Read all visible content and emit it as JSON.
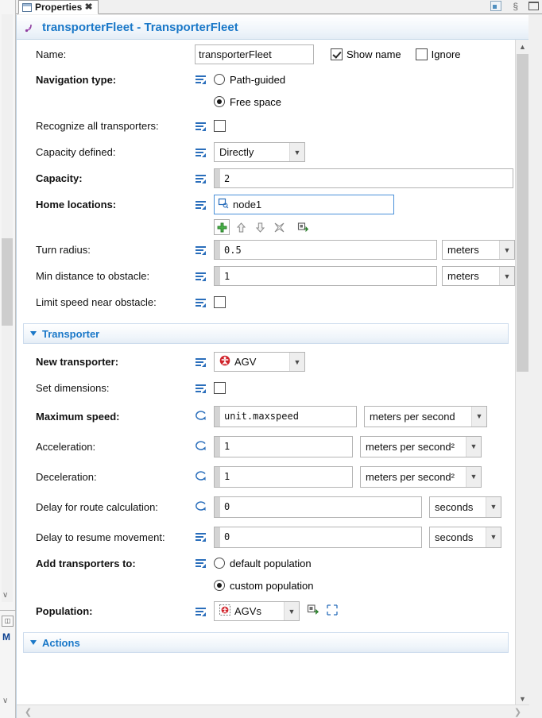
{
  "window": {
    "tab": {
      "label": "Properties",
      "icon": "properties-view-icon",
      "close_icon": "close-icon"
    },
    "toolbar": {
      "minimize_icon": "minimize-icon",
      "link_icon": "link-with-editor-icon",
      "maximize_icon": "maximize-icon"
    }
  },
  "header": {
    "icon": "transporter-fleet-icon",
    "title": "transporterFleet - TransporterFleet",
    "accent_color": "#1a78c8"
  },
  "general": {
    "name": {
      "label": "Name:",
      "value": "transporterFleet",
      "show_name": {
        "label": "Show name",
        "checked": true
      },
      "ignore": {
        "label": "Ignore",
        "checked": false
      }
    },
    "navigation_type": {
      "label": "Navigation type:",
      "icon": "static-value-icon",
      "options": [
        {
          "label": "Path-guided",
          "selected": false
        },
        {
          "label": "Free space",
          "selected": true
        }
      ]
    },
    "recognize_all_transporters": {
      "label": "Recognize all transporters:",
      "icon": "static-value-icon",
      "checked": false
    },
    "capacity_defined": {
      "label": "Capacity defined:",
      "icon": "static-value-icon",
      "value": "Directly"
    },
    "capacity": {
      "label": "Capacity:",
      "icon": "static-value-icon",
      "value": "2"
    },
    "home_locations": {
      "label": "Home locations:",
      "icon": "static-value-icon",
      "value": "node1",
      "item_icon": "node-icon",
      "buttons": [
        {
          "name": "add-button",
          "icon": "plus-icon"
        },
        {
          "name": "move-up-button",
          "icon": "arrow-up-icon"
        },
        {
          "name": "move-down-button",
          "icon": "arrow-down-icon"
        },
        {
          "name": "remove-button",
          "icon": "x-icon"
        },
        {
          "name": "navigate-to-button",
          "icon": "jump-to-icon"
        }
      ]
    },
    "turn_radius": {
      "label": "Turn radius:",
      "icon": "static-value-icon",
      "value": "0.5",
      "unit": "meters"
    },
    "min_distance_to_obstacle": {
      "label": "Min distance to obstacle:",
      "icon": "static-value-icon",
      "value": "1",
      "unit": "meters"
    },
    "limit_speed_near_obstacle": {
      "label": "Limit speed near obstacle:",
      "icon": "static-value-icon",
      "checked": false
    }
  },
  "transporter_section": {
    "title": "Transporter",
    "collapse_icon": "triangle-down-icon",
    "new_transporter": {
      "label": "New transporter:",
      "icon": "static-value-icon",
      "value": "AGV",
      "value_icon": "agv-agent-icon"
    },
    "set_dimensions": {
      "label": "Set dimensions:",
      "icon": "static-value-icon",
      "checked": false
    },
    "maximum_speed": {
      "label": "Maximum speed:",
      "icon": "dynamic-value-icon",
      "value": "unit.maxspeed",
      "unit": "meters per second"
    },
    "acceleration": {
      "label": "Acceleration:",
      "icon": "dynamic-value-icon",
      "value": "1",
      "unit": "meters per second²"
    },
    "deceleration": {
      "label": "Deceleration:",
      "icon": "dynamic-value-icon",
      "value": "1",
      "unit": "meters per second²"
    },
    "delay_for_route_calculation": {
      "label": "Delay for route calculation:",
      "icon": "dynamic-value-icon",
      "value": "0",
      "unit": "seconds"
    },
    "delay_to_resume_movement": {
      "label": "Delay to resume movement:",
      "icon": "static-value-icon",
      "value": "0",
      "unit": "seconds"
    },
    "add_transporters_to": {
      "label": "Add transporters to:",
      "icon": "static-value-icon",
      "options": [
        {
          "label": "default population",
          "selected": false
        },
        {
          "label": "custom population",
          "selected": true
        }
      ]
    },
    "population": {
      "label": "Population:",
      "icon": "static-value-icon",
      "value": "AGVs",
      "value_icon": "agv-population-icon",
      "buttons": [
        {
          "name": "navigate-to-population-button",
          "icon": "jump-to-icon"
        },
        {
          "name": "select-population-button",
          "icon": "marquee-select-icon"
        }
      ]
    }
  },
  "actions_section": {
    "title": "Actions",
    "collapse_icon": "triangle-down-icon"
  },
  "scrollbars": {
    "vertical": {
      "up_icon": "chevron-up-icon",
      "down_icon": "chevron-down-icon"
    },
    "horizontal": {
      "left_icon": "chevron-left-icon",
      "right_icon": "chevron-right-icon"
    }
  }
}
